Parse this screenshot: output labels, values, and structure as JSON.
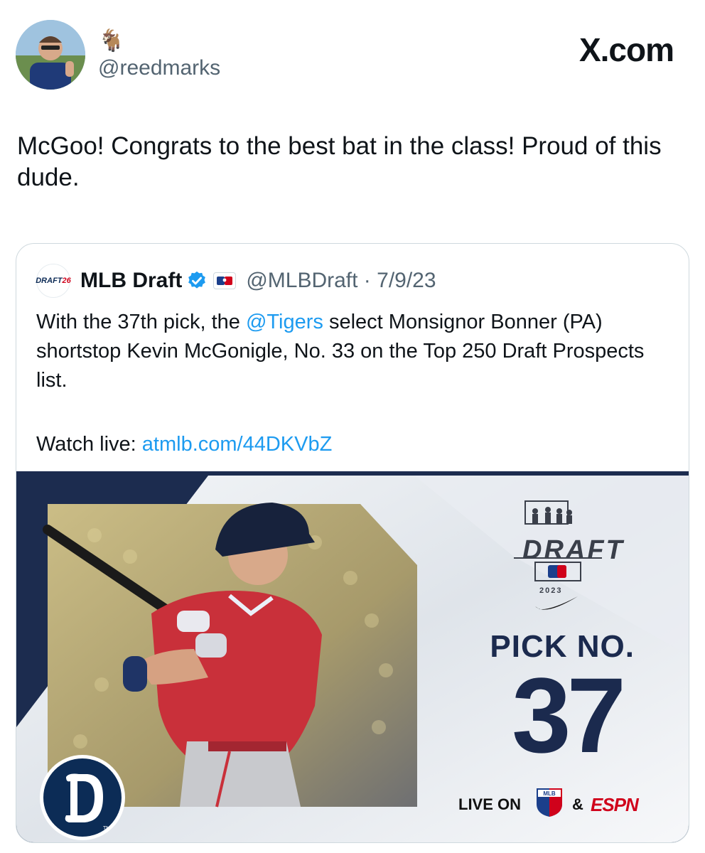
{
  "header": {
    "emoji": "🐐",
    "handle": "@reedmarks",
    "site_label": "X.com"
  },
  "tweet": {
    "text": "McGoo! Congrats to the best bat in the class! Proud of this dude."
  },
  "quoted": {
    "logo_text_a": "DRAFT",
    "logo_text_b": "26",
    "name": "MLB Draft",
    "handle_date": "@MLBDraft · 7/9/23",
    "body_pre": "With the 37th pick, the ",
    "body_mention": "@Tigers",
    "body_post": " select Monsignor Bonner (PA) shortstop Kevin McGonigle, No. 33 on the Top 250 Draft Prospects list.",
    "watch_label": "Watch live: ",
    "watch_link": "atmlb.com/44DKVbZ"
  },
  "graphic": {
    "draft_word": "DRAFT",
    "draft_year": "2023",
    "pick_label": "PICK NO.",
    "pick_number": "37",
    "live_on": "LIVE ON",
    "amp": "&",
    "espn": "ESPN",
    "mlb_network": "MLB",
    "tm": "TM"
  },
  "colors": {
    "link": "#1d9bf0",
    "navy": "#1b2a4e",
    "muted": "#536471",
    "verified": "#1d9bf0"
  }
}
